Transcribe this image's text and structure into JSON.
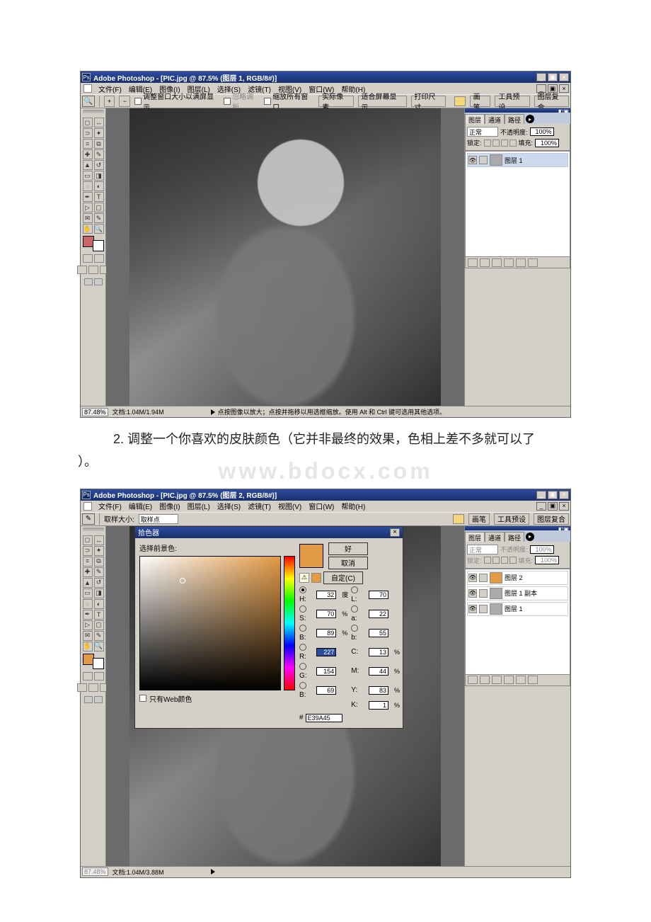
{
  "shot1": {
    "title": "Adobe Photoshop - [PIC.jpg @ 87.5% (图层 1, RGB/8#)]",
    "menus": [
      "文件(F)",
      "编辑(E)",
      "图像(I)",
      "图层(L)",
      "选择(S)",
      "滤镜(T)",
      "视图(V)",
      "窗口(W)",
      "帮助(H)"
    ],
    "opt_resize": "调整窗口大小以满屏显示",
    "opt_ignore": "忽略调板",
    "opt_zoomall": "缩放所有窗口",
    "opt_actual": "实际像素",
    "opt_fit": "适合屏幕显示",
    "opt_print": "打印尺寸",
    "right_tabs": [
      "画笔",
      "工具预设",
      "图层复合"
    ],
    "panel_tabs": [
      "图层",
      "通道",
      "路径"
    ],
    "blend_mode": "正常",
    "opacity_label": "不透明度:",
    "opacity_value": "100%",
    "lock_label": "锁定:",
    "fill_label": "填充:",
    "fill_value": "100%",
    "layers": [
      "图层 1"
    ],
    "status_zoom": "87.48%",
    "status_doc": "文档:1.04M/1.94M",
    "status_tip": "点按图像以放大；点按并拖移以用选框缩放。使用 Alt 和 Ctrl 键可选用其他选项。"
  },
  "caption": {
    "line1": "2. 调整一个你喜欢的皮肤颜色（它并非最终的效果，色相上差不多就可以了",
    "line2": "）。"
  },
  "watermark": "www.bdocx.com",
  "shot2": {
    "title": "Adobe Photoshop - [PIC.jpg @ 87.5% (图层 2, RGB/8#)]",
    "menus": [
      "文件(F)",
      "编辑(E)",
      "图像(I)",
      "图层(L)",
      "选择(S)",
      "滤镜(T)",
      "视图(V)",
      "窗口(W)",
      "帮助(H)"
    ],
    "opt_sampsize_label": "取样大小:",
    "opt_sampsize_value": "取样点",
    "right_tabs": [
      "画笔",
      "工具预设",
      "图层复合"
    ],
    "panel_tabs": [
      "图层",
      "通道",
      "路径"
    ],
    "blend_mode": "正常",
    "opacity_label": "不透明度:",
    "opacity_value": "100%",
    "lock_label": "锁定:",
    "fill_label": "填充:",
    "fill_value": "100%",
    "layers": [
      "图层 2",
      "图层 1 副本",
      "图层 1"
    ],
    "status_zoom": "87.48%",
    "status_doc": "文档:1.04M/3.88M",
    "picker": {
      "title": "拾色器",
      "select_label": "选择前景色:",
      "ok": "好",
      "cancel": "取消",
      "custom": "自定(C)",
      "only_web": "只有Web颜色",
      "H": "32",
      "H_unit": "度",
      "S": "70",
      "S_unit": "%",
      "Bv": "89",
      "Bv_unit": "%",
      "L": "70",
      "a": "22",
      "bb": "55",
      "R": "227",
      "G": "154",
      "Bc": "69",
      "C": "13",
      "C_unit": "%",
      "M": "44",
      "M_unit": "%",
      "Y": "83",
      "Y_unit": "%",
      "K": "1",
      "K_unit": "%",
      "hex": "E39A45"
    }
  }
}
